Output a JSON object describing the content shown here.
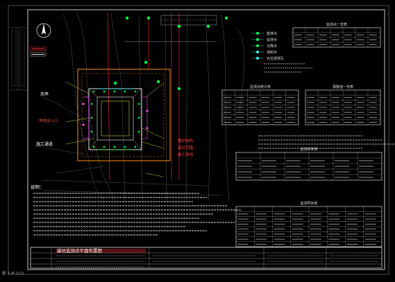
{
  "drawing": {
    "status_text": "图 5-B-1(2)",
    "background": "#000000",
    "colors": {
      "frame": "#ffffff",
      "site_boundary": "#ff8c1a",
      "pit": "#ffffff",
      "road": "#ff3030",
      "survey_point": "#00ff40",
      "label_red": "#ff3030",
      "label_yellow": "#ffff40",
      "accent_magenta": "#ff40ff",
      "accent_cyan": "#40ffff"
    }
  },
  "legend": {
    "items": [
      {
        "label": "基准点",
        "icon": "green-circle-marker"
      },
      {
        "label": "监测点",
        "icon": "green-triangle-marker"
      },
      {
        "label": "沉降点",
        "icon": "green-cross-marker"
      },
      {
        "label": "测斜点",
        "icon": "cyan-dot-marker"
      },
      {
        "label": "水位观测孔",
        "icon": "cyan-dot-marker"
      }
    ]
  },
  "tables": [
    {
      "title": "监测点一览表"
    },
    {
      "title": "监测点统计表"
    },
    {
      "title": "报警值一览表"
    },
    {
      "title": "监测频率表"
    },
    {
      "title": "监测项目表"
    }
  ],
  "plan_labels": {
    "left_labels": [
      "地铁出入口",
      "风亭",
      "施工通道"
    ],
    "right_labels": [
      "围护结构",
      "基坑范围",
      "施工场地"
    ],
    "notes_title": "说明："
  },
  "title_block": {
    "title": "基坑监测点平面布置图"
  }
}
